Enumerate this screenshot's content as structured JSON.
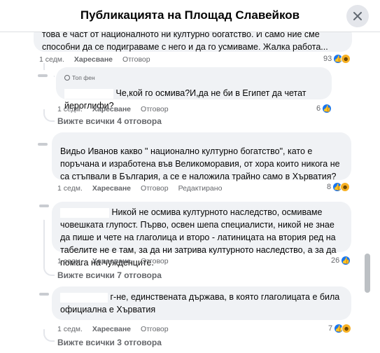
{
  "header": {
    "title": "Публикацията на Площад Славейков"
  },
  "comments": [
    {
      "text": "това е част от националното ни културно богатство. И само ние сме способни да се подиграваме с него и да го усмиваме. Жалка работа...",
      "time": "1 седм.",
      "like": "Харесване",
      "reply": "Отговор",
      "reaction_count": "93",
      "reactions": [
        "like",
        "haha"
      ]
    },
    {
      "badge": "Топ фен",
      "text": "Че,кой го осмива?И,да не би в Египет да четат йероглифи?",
      "time": "1 седм.",
      "like": "Харесване",
      "reply": "Отговор",
      "reaction_count": "6",
      "reactions": [
        "like"
      ],
      "view_replies": "Вижте всички 4 отговора"
    },
    {
      "text": "Видьо Иванов какво \" национално културно богатство\", като е поръчана и изработена във Великоморавия, от хора които никога не са стъпвали в България, а се е наложила трайно само в Хърватия?",
      "time": "1 седм.",
      "like": "Харесване",
      "reply": "Отговор",
      "edited": "Редактирано",
      "reaction_count": "8",
      "reactions": [
        "like",
        "haha"
      ]
    },
    {
      "text": "Никой не осмива културното наследство, осмиваме човешката глупост. Първо, освен шепа специалисти, никой не знае да пише и чете на глаголица и второ - латиницата на втория ред на табелите не е там, за да ни затрива културното наследство, а за да помага на чужденците.",
      "time": "1 седм.",
      "like": "Харесване",
      "reply": "Отговор",
      "reaction_count": "26",
      "reactions": [
        "like"
      ],
      "view_replies": "Вижте всички 7 отговора"
    },
    {
      "text": "г-не, единствената държава, в която глаголицата е била официална е Хърватия",
      "time": "1 седм.",
      "like": "Харесване",
      "reply": "Отговор",
      "reaction_count": "7",
      "reactions": [
        "like",
        "haha"
      ],
      "view_replies": "Вижте всички 3 отговора"
    }
  ],
  "icons": {
    "close": "close-icon",
    "like": "like-reaction-icon",
    "haha": "haha-reaction-icon",
    "badge": "top-fan-badge-icon"
  },
  "colors": {
    "like": "#1877f2",
    "haha": "#f7b125",
    "bubble": "#f0f2f5",
    "meta": "#65676b"
  }
}
